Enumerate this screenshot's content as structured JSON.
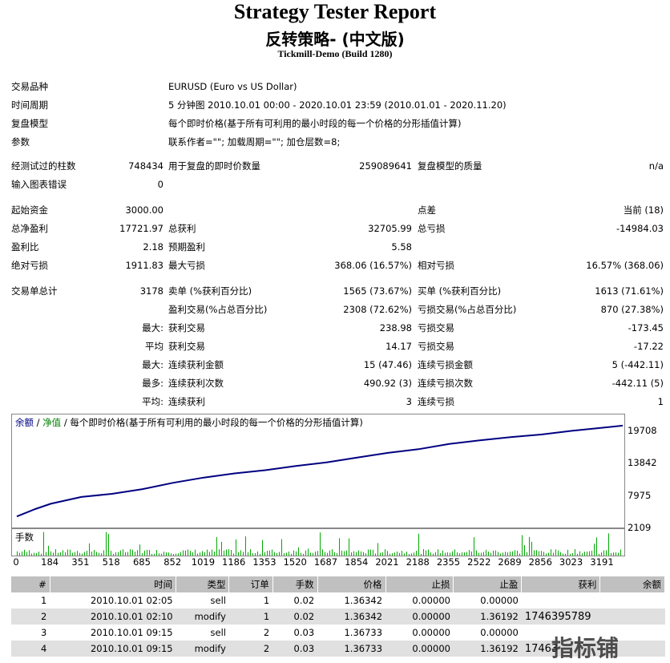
{
  "header": {
    "title": "Strategy Tester Report",
    "subtitle": "反转策略- (中文版)",
    "build": "Tickmill-Demo (Build 1280)"
  },
  "info": [
    {
      "label": "交易品种",
      "value": "EURUSD (Euro vs US Dollar)"
    },
    {
      "label": "时间周期",
      "value": "5 分钟图 2010.10.01 00:00 - 2020.10.01 23:59 (2010.01.01 - 2020.11.20)"
    },
    {
      "label": "复盘模型",
      "value": "每个即时价格(基于所有可利用的最小时段的每一个价格的分形插值计算)"
    },
    {
      "label": "参数",
      "value": "联系作者=\"\"; 加载周期=\"\"; 加仓层数=8;"
    }
  ],
  "bars": {
    "bars_label": "经测试过的柱数",
    "bars_value": "748434",
    "ticks_label": "用于复盘的即时价数量",
    "ticks_value": "259089641",
    "quality_label": "复盘模型的质量",
    "quality_value": "n/a",
    "errors_label": "输入图表错误",
    "errors_value": "0"
  },
  "stats": {
    "deposit_label": "起始资金",
    "deposit_value": "3000.00",
    "spread_label": "点差",
    "spread_value": "当前 (18)",
    "net_label": "总净盈利",
    "net_value": "17721.97",
    "gross_profit_label": "总获利",
    "gross_profit_value": "32705.99",
    "gross_loss_label": "总亏损",
    "gross_loss_value": "-14984.03",
    "pf_label": "盈利比",
    "pf_value": "2.18",
    "payoff_label": "预期盈利",
    "payoff_value": "5.58",
    "abs_dd_label": "绝对亏损",
    "abs_dd_value": "1911.83",
    "max_dd_label": "最大亏损",
    "max_dd_value": "368.06 (16.57%)",
    "rel_dd_label": "相对亏损",
    "rel_dd_value": "16.57% (368.06)"
  },
  "trades": {
    "total_label": "交易单总计",
    "total_value": "3178",
    "short_label": "卖单 (%获利百分比)",
    "short_value": "1565 (73.67%)",
    "long_label": "买单 (%获利百分比)",
    "long_value": "1613 (71.61%)",
    "win_label": "盈利交易(%占总百分比)",
    "win_value": "2308 (72.62%)",
    "loss_label": "亏损交易(%占总百分比)",
    "loss_value": "870 (27.38%)",
    "largest_prefix": "最大:",
    "largest_win_label": "获利交易",
    "largest_win_value": "238.98",
    "largest_loss_label": "亏损交易",
    "largest_loss_value": "-173.45",
    "avg_prefix": "平均",
    "avg_win_label": "获利交易",
    "avg_win_value": "14.17",
    "avg_loss_label": "亏损交易",
    "avg_loss_value": "-17.22",
    "max_prefix": "最大:",
    "max_cons_wins_label": "连续获利金额",
    "max_cons_wins_value": "15 (47.46)",
    "max_cons_losses_label": "连续亏损金额",
    "max_cons_losses_value": "5 (-442.11)",
    "most_prefix": "最多:",
    "most_cons_profit_label": "连续获利次数",
    "most_cons_profit_value": "490.92 (3)",
    "most_cons_loss_label": "连续亏损次数",
    "most_cons_loss_value": "-442.11 (5)",
    "avgc_prefix": "平均:",
    "avg_cons_wins_label": "连续获利",
    "avg_cons_wins_value": "3",
    "avg_cons_losses_label": "连续亏损",
    "avg_cons_losses_value": "1"
  },
  "chart_legend": {
    "balance": "余额",
    "sep1": " / ",
    "equity": "净值",
    "sep2": " / ",
    "model": "每个即时价格(基于所有可利用的最小时段的每一个价格的分形插值计算)",
    "volume_label": "手数",
    "balance_color": "#000080",
    "equity_color": "#008000",
    "volume_color": "#00aa00"
  },
  "chart_data": {
    "type": "line",
    "y_ticks": [
      "19708",
      "13842",
      "7975",
      "2109"
    ],
    "x_ticks": [
      "0",
      "184",
      "351",
      "518",
      "685",
      "852",
      "1019",
      "1186",
      "1353",
      "1520",
      "1687",
      "1854",
      "2021",
      "2188",
      "2355",
      "2522",
      "2689",
      "2856",
      "3023",
      "3191"
    ],
    "xlim": [
      0,
      3300
    ],
    "ylim": [
      2109,
      21500
    ],
    "series": [
      {
        "name": "余额",
        "x": [
          0,
          100,
          184,
          351,
          518,
          685,
          852,
          1019,
          1186,
          1353,
          1520,
          1687,
          1854,
          2021,
          2188,
          2355,
          2522,
          2689,
          2856,
          3023,
          3191,
          3300
        ],
        "y": [
          3000,
          4400,
          5400,
          6700,
          7300,
          8200,
          9400,
          10400,
          11200,
          11800,
          12600,
          13300,
          14200,
          15100,
          15800,
          16800,
          17500,
          18100,
          18600,
          19300,
          19900,
          20300
        ]
      }
    ]
  },
  "table": {
    "headers": [
      "#",
      "时间",
      "类型",
      "订单",
      "手数",
      "价格",
      "止损",
      "止盈",
      "获利",
      "余额"
    ],
    "rows": [
      [
        "1",
        "2010.10.01 02:05",
        "sell",
        "1",
        "0.02",
        "1.36342",
        "0.00000",
        "0.00000",
        "",
        ""
      ],
      [
        "2",
        "2010.10.01 02:10",
        "modify",
        "1",
        "0.02",
        "1.36342",
        "0.00000",
        "1.36192",
        "1746395789",
        ""
      ],
      [
        "3",
        "2010.10.01 09:15",
        "sell",
        "2",
        "0.03",
        "1.36733",
        "0.00000",
        "0.00000",
        "",
        ""
      ],
      [
        "4",
        "2010.10.01 09:15",
        "modify",
        "2",
        "0.03",
        "1.36733",
        "0.00000",
        "1.36192",
        "17463",
        ""
      ]
    ]
  },
  "watermark": "指标铺"
}
